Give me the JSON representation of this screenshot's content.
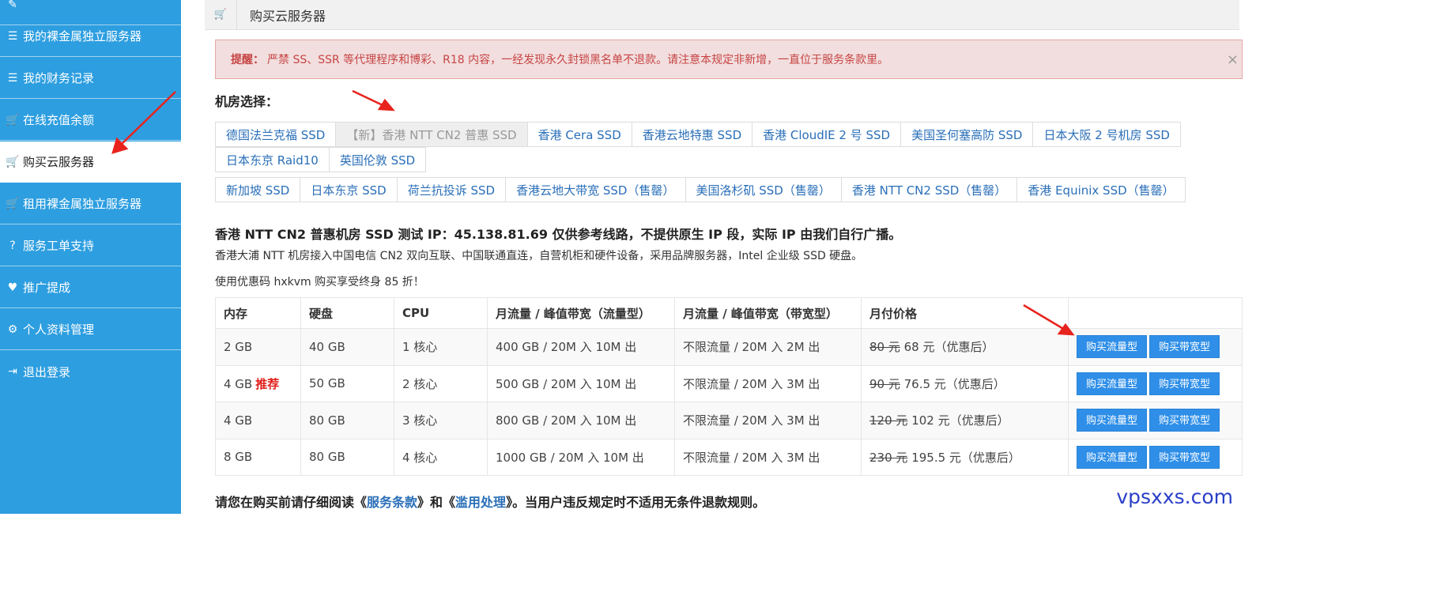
{
  "sidebar": {
    "items": [
      {
        "label": "我的裸金属独立服务器",
        "icon": "bars-icon"
      },
      {
        "label": "我的财务记录",
        "icon": "bars-icon"
      },
      {
        "label": "在线充值余额",
        "icon": "cart-icon"
      },
      {
        "label": "购买云服务器",
        "icon": "cart-icon",
        "active": true
      },
      {
        "label": "租用裸金属独立服务器",
        "icon": "cart-icon"
      },
      {
        "label": "服务工单支持",
        "icon": "question-circle-icon"
      },
      {
        "label": "推广提成",
        "icon": "heart-icon"
      },
      {
        "label": "个人资料管理",
        "icon": "gear-icon"
      },
      {
        "label": "退出登录",
        "icon": "sign-out-icon"
      }
    ]
  },
  "header": {
    "title": "购买云服务器"
  },
  "alert": {
    "label": "提醒：",
    "text": "严禁 SS、SSR 等代理程序和博彩、R18 内容，一经发现永久封锁黑名单不退款。请注意本规定非新增，一直位于服务条款里。",
    "close": "×"
  },
  "rooms": {
    "heading": "机房选择：",
    "row1": [
      "德国法兰克福 SSD",
      "【新】香港 NTT CN2 普惠 SSD",
      "香港 Cera SSD",
      "香港云地特惠 SSD",
      "香港 CloudIE 2 号 SSD",
      "美国圣何塞高防 SSD",
      "日本大阪 2 号机房 SSD"
    ],
    "row2": [
      "日本东京 Raid10",
      "英国伦敦 SSD"
    ],
    "row3": [
      "新加坡 SSD",
      "日本东京 SSD",
      "荷兰抗投诉 SSD",
      "香港云地大带宽 SSD（售罄）",
      "美国洛杉矶 SSD（售罄）",
      "香港 NTT CN2 SSD（售罄）",
      "香港 Equinix SSD（售罄）"
    ],
    "active": "【新】香港 NTT CN2 普惠 SSD"
  },
  "info": {
    "title": "香港 NTT CN2 普惠机房 SSD 测试 IP：45.138.81.69 仅供参考线路，不提供原生 IP 段，实际 IP 由我们自行广播。",
    "desc": "香港大浦 NTT 机房接入中国电信 CN2 双向互联、中国联通直连，自营机柜和硬件设备，采用品牌服务器，Intel 企业级 SSD 硬盘。",
    "promo": "使用优惠码 hxkvm 购买享受终身 85 折！"
  },
  "table": {
    "headers": [
      "内存",
      "硬盘",
      "CPU",
      "月流量 / 峰值带宽（流量型）",
      "月流量 / 峰值带宽（带宽型）",
      "月付价格",
      ""
    ],
    "rows": [
      {
        "mem": "2 GB",
        "tag": "",
        "disk": "40 GB",
        "cpu": "1 核心",
        "traffic": "400 GB / 20M 入 10M 出",
        "bandwidth": "不限流量 / 20M 入 2M 出",
        "old": "80 元",
        "price": "68 元（优惠后）"
      },
      {
        "mem": "4 GB",
        "tag": "推荐",
        "disk": "50 GB",
        "cpu": "2 核心",
        "traffic": "500 GB / 20M 入 10M 出",
        "bandwidth": "不限流量 / 20M 入 3M 出",
        "old": "90 元",
        "price": "76.5 元（优惠后）"
      },
      {
        "mem": "4 GB",
        "tag": "",
        "disk": "80 GB",
        "cpu": "3 核心",
        "traffic": "800 GB / 20M 入 10M 出",
        "bandwidth": "不限流量 / 20M 入 3M 出",
        "old": "120 元",
        "price": "102 元（优惠后）"
      },
      {
        "mem": "8 GB",
        "tag": "",
        "disk": "80 GB",
        "cpu": "4 核心",
        "traffic": "1000 GB / 20M 入 10M 出",
        "bandwidth": "不限流量 / 20M 入 3M 出",
        "old": "230 元",
        "price": "195.5 元（优惠后）"
      }
    ],
    "btn_traffic": "购买流量型",
    "btn_bandwidth": "购买带宽型"
  },
  "note": {
    "pre": "请您在购买前请仔细阅读《",
    "terms": "服务条款",
    "mid": "》和《",
    "abuse": "滥用处理",
    "post": "》。当用户违反规定时不适用无条件退款规则。"
  },
  "watermark": "vpsxxs.com",
  "colors": {
    "sidebar": "#2d9ee0",
    "button": "#2f8fe8",
    "link": "#2a6fb8",
    "alert_bg": "#f2dede",
    "arrow": "#e8231d"
  }
}
